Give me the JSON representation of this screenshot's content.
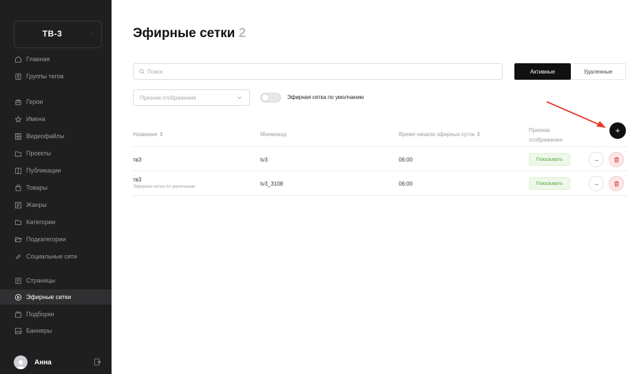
{
  "sidebar": {
    "brand": "ТВ-3",
    "items": [
      {
        "label": "Главная",
        "icon": "home-icon"
      },
      {
        "label": "Группы тегов",
        "icon": "tag-group-icon"
      },
      {
        "label": "Герои",
        "icon": "hero-icon"
      },
      {
        "label": "Имена",
        "icon": "star-icon"
      },
      {
        "label": "Видеофайлы",
        "icon": "film-icon"
      },
      {
        "label": "Проекты",
        "icon": "project-icon"
      },
      {
        "label": "Публикации",
        "icon": "publication-icon"
      },
      {
        "label": "Товары",
        "icon": "bag-icon"
      },
      {
        "label": "Жанры",
        "icon": "genre-icon"
      },
      {
        "label": "Категории",
        "icon": "folder-icon"
      },
      {
        "label": "Подкатегории",
        "icon": "folder-open-icon"
      },
      {
        "label": "Социальные сети",
        "icon": "link-icon"
      },
      {
        "label": "Страницы",
        "icon": "page-icon"
      },
      {
        "label": "Эфирные сетки",
        "icon": "play-circle-icon"
      },
      {
        "label": "Подборки",
        "icon": "collection-icon"
      },
      {
        "label": "Баннеры",
        "icon": "image-icon"
      }
    ],
    "active_index": 13,
    "user": {
      "name": "Анна"
    }
  },
  "header": {
    "title": "Эфирные сетки",
    "count": "2"
  },
  "search": {
    "placeholder": "Поиск"
  },
  "tabs": [
    {
      "label": "Активные",
      "active": true
    },
    {
      "label": "Удаленные",
      "active": false
    }
  ],
  "filters": {
    "display_placeholder": "Признак отображения",
    "default_toggle_label": "Эфирная сетка по умолчанию",
    "default_toggle_on": false
  },
  "table": {
    "columns": [
      "Название ⇕",
      "Мнемокод",
      "Время начала эфирных суток ⇕",
      "Признак отображения"
    ],
    "add_label": "+",
    "rows": [
      {
        "name": "тв3",
        "subtitle": "",
        "code": "tv3",
        "start": "06:00",
        "display": "Показывать"
      },
      {
        "name": "тв3",
        "subtitle": "Эфирная сетка по умолчанию",
        "code": "tv3_3108",
        "start": "06:00",
        "display": "Показывать"
      }
    ]
  },
  "colors": {
    "sidebar_bg": "#1f1f20",
    "accent": "#111111",
    "annotation_arrow": "#e53b2c",
    "badge_text": "#5aa640"
  }
}
